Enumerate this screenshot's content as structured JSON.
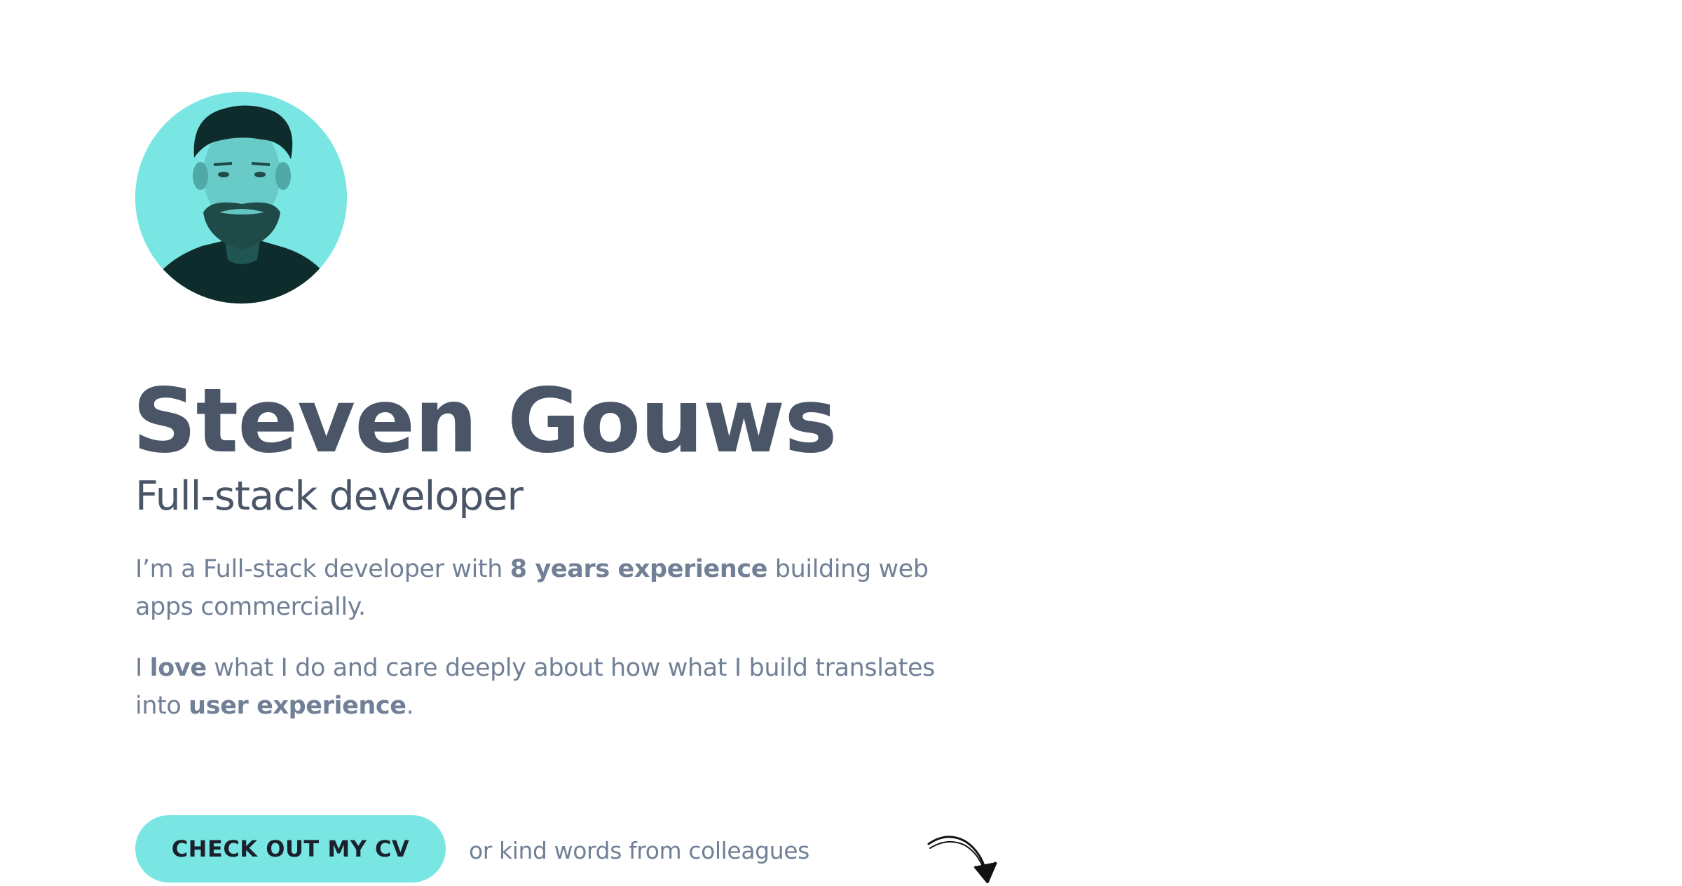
{
  "profile": {
    "name": "Steven Gouws",
    "role": "Full-stack developer",
    "avatar_tint": "#7ae6e3"
  },
  "intro": {
    "p1_a": "I’m a Full-stack developer with ",
    "p1_b": "8 years experience",
    "p1_c": " building web apps commercially.",
    "p2_a": "I ",
    "p2_b": "love",
    "p2_c": " what I do and care deeply about how what I build translates into ",
    "p2_d": "user experience",
    "p2_e": "."
  },
  "actions": {
    "cv_label": "CHECK OUT MY CV",
    "aside": "or kind words from colleagues",
    "arrow_icon": "curved-arrow-down-icon"
  },
  "colors": {
    "accent": "#7ae6e3",
    "heading": "#4a5568",
    "body": "#718096"
  }
}
